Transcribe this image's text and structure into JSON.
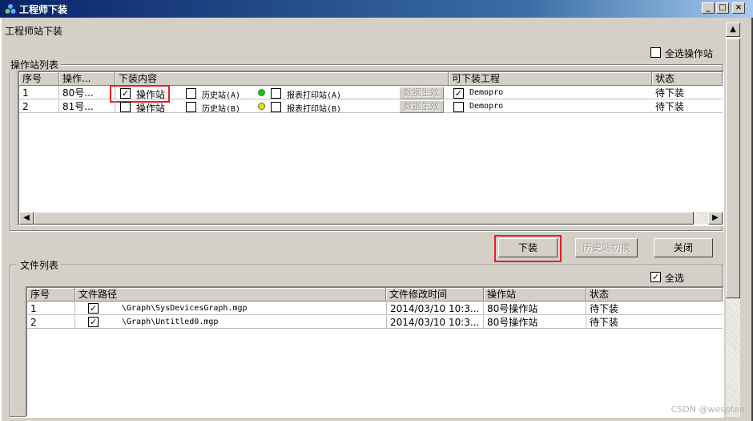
{
  "window": {
    "title": "工程师下装",
    "subheader": "工程师站下装",
    "controls": [
      "_",
      "□",
      "×"
    ]
  },
  "station_group": {
    "label": "操作站列表",
    "select_all_label": "全选操作站",
    "select_all_checked": false,
    "columns": [
      "序号",
      "操作...",
      "下装内容",
      "可下装工程",
      "状态"
    ],
    "rows": [
      {
        "index": "1",
        "name": "80号...",
        "op_checked": true,
        "op_label": "操作站",
        "hist_checked": false,
        "hist_label": "历史站(A)",
        "hist_status_color": "#00d000",
        "report_checked": false,
        "report_label": "报表打印站(A)",
        "apply_label": "数据生效",
        "project_checked": true,
        "project": "Demopro",
        "status": "待下装"
      },
      {
        "index": "2",
        "name": "81号...",
        "op_checked": false,
        "op_label": "操作站",
        "hist_checked": false,
        "hist_label": "历史站(B)",
        "hist_status_color": "#f0e000",
        "report_checked": false,
        "report_label": "报表打印站(B)",
        "apply_label": "数据生效",
        "project_checked": false,
        "project": "Demopro",
        "status": "待下装"
      }
    ]
  },
  "buttons": {
    "download": "下装",
    "switch_history": "历史站切换",
    "close": "关闭"
  },
  "file_group": {
    "label": "文件列表",
    "select_all_label": "全选",
    "select_all_checked": true,
    "columns": [
      "序号",
      "文件路径",
      "文件修改时间",
      "操作站",
      "状态"
    ],
    "rows": [
      {
        "index": "1",
        "checked": true,
        "path": "\\Graph\\SysDevicesGraph.mgp",
        "time": "2014/03/10 10:3...",
        "station": "80号操作站",
        "status": "待下装"
      },
      {
        "index": "2",
        "checked": true,
        "path": "\\Graph\\Untitled0.mgp",
        "time": "2014/03/10 10:3...",
        "station": "80号操作站",
        "status": "待下装"
      }
    ]
  },
  "watermark": "CSDN @wespten"
}
